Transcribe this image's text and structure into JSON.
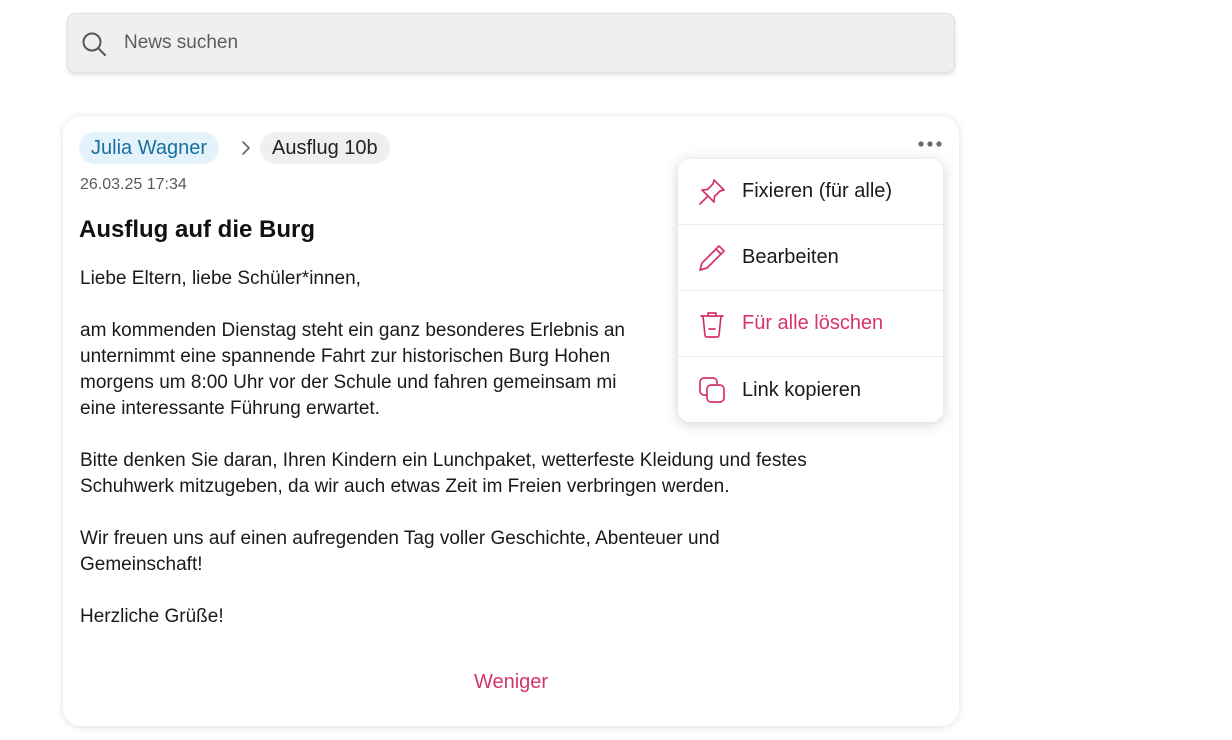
{
  "search": {
    "placeholder": "News suchen",
    "icon": "search-icon"
  },
  "post": {
    "author": "Julia Wagner",
    "group": "Ausflug 10b",
    "date": "26.03.25 17:34",
    "title": "Ausflug auf die Burg",
    "paragraphs": [
      "Liebe Eltern, liebe Schüler*innen,",
      "am kommenden Dienstag steht ein ganz besonderes Erlebnis an\nunternimmt eine spannende Fahrt zur historischen Burg Hohen\nmorgens um 8:00 Uhr vor der Schule und fahren gemeinsam mi\neine interessante Führung erwartet.",
      "Bitte denken Sie daran, Ihren Kindern ein Lunchpaket, wetterfeste Kleidung und festes\nSchuhwerk mitzugeben, da wir auch etwas Zeit im Freien verbringen werden.",
      "Wir freuen uns auf einen aufregenden Tag voller Geschichte, Abenteuer und\nGemeinschaft!",
      "Herzliche Grüße!"
    ],
    "less_label": "Weniger"
  },
  "menu": {
    "items": [
      {
        "label": "Fixieren (für alle)",
        "icon": "pin-icon"
      },
      {
        "label": "Bearbeiten",
        "icon": "pencil-icon"
      },
      {
        "label": "Für alle löschen",
        "icon": "trash-icon"
      },
      {
        "label": "Link kopieren",
        "icon": "copy-icon"
      }
    ]
  },
  "colors": {
    "accent": "#d6336c",
    "author_chip_bg": "#e3f2fb",
    "author_chip_text": "#1b6f9e"
  }
}
